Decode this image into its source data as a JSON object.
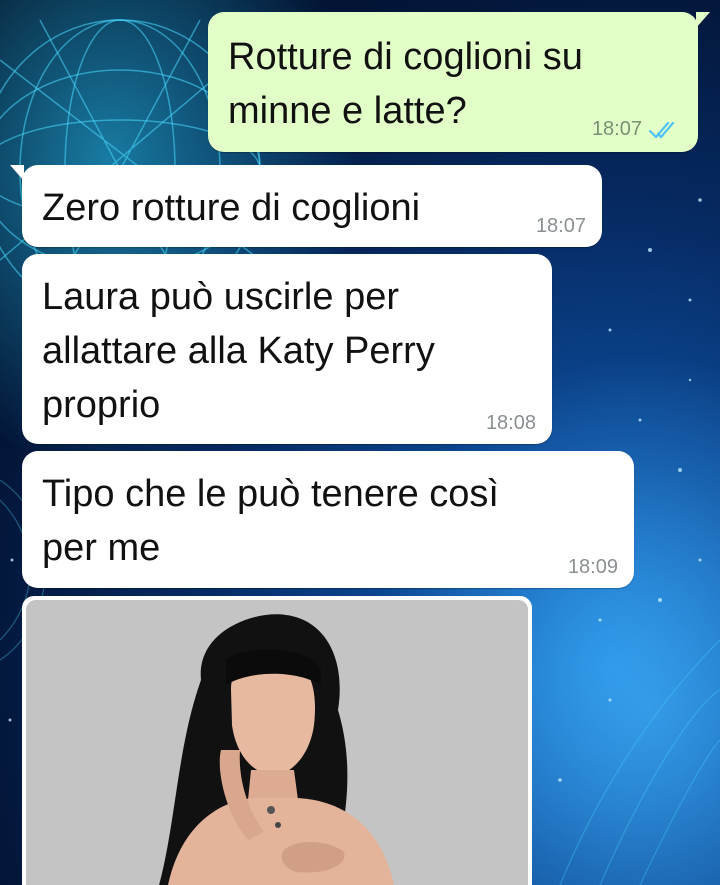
{
  "messages": [
    {
      "direction": "outgoing",
      "text": "Rotture di coglioni su\nminne e latte?",
      "time": "18:07",
      "status": "read-double-check"
    },
    {
      "direction": "incoming",
      "text": "Zero rotture di coglioni",
      "time": "18:07"
    },
    {
      "direction": "incoming",
      "text": "Laura può uscirle per\nallattare alla Katy Perry\nproprio",
      "time": "18:08"
    },
    {
      "direction": "incoming",
      "text": "Tipo che le può tenere così\nper me",
      "time": "18:09"
    },
    {
      "direction": "incoming",
      "type": "image"
    }
  ],
  "colors": {
    "outgoing_bubble": "#e2ffc8",
    "incoming_bubble": "#ffffff",
    "read_ticks": "#4fc3f7",
    "wallpaper_base": "#031536"
  },
  "icons": {
    "read_status": "double-check-icon"
  }
}
